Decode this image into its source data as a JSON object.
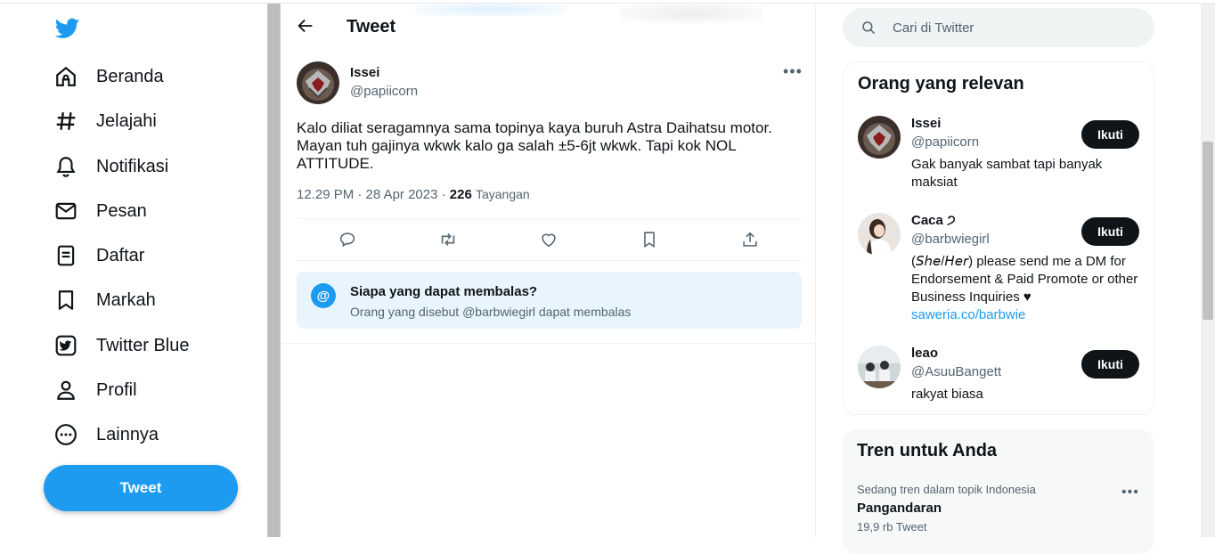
{
  "nav": {
    "items": [
      {
        "label": "Beranda",
        "icon": "home-icon"
      },
      {
        "label": "Jelajahi",
        "icon": "hashtag-icon"
      },
      {
        "label": "Notifikasi",
        "icon": "bell-icon"
      },
      {
        "label": "Pesan",
        "icon": "mail-icon"
      },
      {
        "label": "Daftar",
        "icon": "list-icon"
      },
      {
        "label": "Markah",
        "icon": "bookmark-icon"
      },
      {
        "label": "Twitter Blue",
        "icon": "twitter-blue-icon"
      },
      {
        "label": "Profil",
        "icon": "person-icon"
      },
      {
        "label": "Lainnya",
        "icon": "more-circle-icon"
      }
    ],
    "tweet_button": "Tweet"
  },
  "main": {
    "title": "Tweet",
    "tweet": {
      "author_name": "Issei",
      "author_handle": "@papiicorn",
      "text": "Kalo diliat seragamnya sama topinya kaya buruh Astra Daihatsu motor. Mayan tuh gajinya wkwk kalo ga salah ±5-6jt wkwk. Tapi kok NOL ATTITUDE.",
      "timestamp": "12.29 PM · 28 Apr 2023 · ",
      "views_count": "226",
      "views_label": "Tayangan"
    },
    "reply_box": {
      "title": "Siapa yang dapat membalas?",
      "subtitle": "Orang yang disebut @barbwiegirl dapat membalas"
    }
  },
  "sidebar": {
    "search_placeholder": "Cari di Twitter",
    "relevant": {
      "title": "Orang yang relevan",
      "people": [
        {
          "name": "Issei",
          "handle": "@papiicorn",
          "bio": "Gak banyak sambat tapi banyak maksiat",
          "follow": "Ikuti"
        },
        {
          "name": "Caca ੭",
          "handle": "@barbwiegirl",
          "bio": "(𝘚𝘩𝘦/𝘏𝘦𝘳) please send me a DM for Endorsement & Paid Promote or other Business Inquiries ♥",
          "link": "saweria.co/barbwie",
          "follow": "Ikuti"
        },
        {
          "name": "leao",
          "handle": "@AsuuBangett",
          "bio": "rakyat biasa",
          "follow": "Ikuti"
        }
      ]
    },
    "trends": {
      "title": "Tren untuk Anda",
      "items": [
        {
          "category": "Sedang tren dalam topik Indonesia",
          "name": "Pangandaran",
          "count": "19,9 rb Tweet"
        }
      ]
    }
  },
  "colors": {
    "accent": "#1d9bf0",
    "text": "#0f1419",
    "secondary": "#536471"
  }
}
